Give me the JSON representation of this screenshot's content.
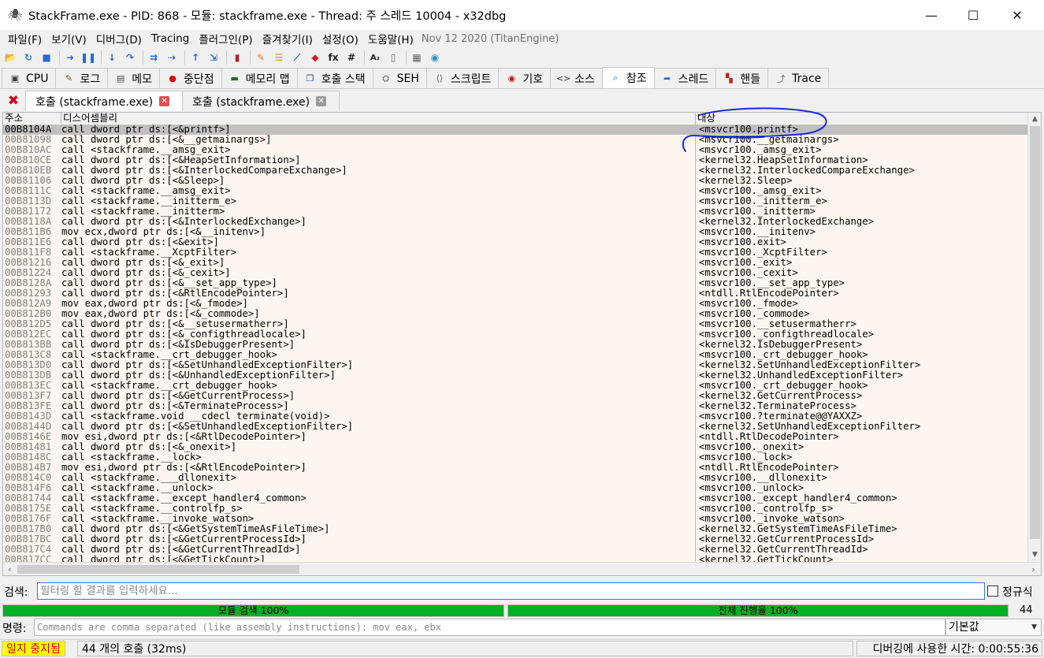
{
  "window": {
    "title": "StackFrame.exe - PID: 868 - 모듈: stackframe.exe - Thread: 주 스레드 10004 - x32dbg",
    "minimize": "—",
    "maximize": "☐",
    "close": "✕"
  },
  "menu": {
    "items": [
      "파일(F)",
      "보기(V)",
      "디버그(D)",
      "Tracing",
      "플러그인(P)",
      "즐겨찾기(I)",
      "설정(O)",
      "도움말(H)"
    ],
    "build": "Nov 12 2020 (TitanEngine)"
  },
  "toolbar": {
    "icons": [
      "open-icon",
      "restart-icon",
      "stop-icon",
      "run-icon",
      "pause-icon",
      "step-into-icon",
      "step-over-icon",
      "trace-into-icon",
      "trace-over-icon",
      "execute-till-return-icon",
      "run-to-user-code-icon",
      "scylla-icon",
      "patches-icon",
      "comments-icon",
      "labels-icon",
      "bookmarks-icon",
      "functions-icon",
      "variables-icon",
      "strings-icon",
      "calculator-icon",
      "globe-icon"
    ],
    "glyphs": [
      "📂",
      "↻",
      "■",
      "➜",
      "❚❚",
      "↓",
      "↷",
      "⇉",
      "⇢",
      "↑",
      "⇲",
      "▮",
      "✎",
      "☰",
      "⟋",
      "◆",
      "fx",
      "#",
      "A₂",
      "▯",
      "▦",
      "◉"
    ]
  },
  "tabs": [
    {
      "label": "CPU",
      "icon": "cpu-icon",
      "glyph": "▣",
      "color": "#3a3a3a"
    },
    {
      "label": "로그",
      "icon": "log-icon",
      "glyph": "✎",
      "color": "#6a5a2a"
    },
    {
      "label": "메모",
      "icon": "notes-icon",
      "glyph": "▤",
      "color": "#4a4a4a"
    },
    {
      "label": "중단점",
      "icon": "breakpoint-icon",
      "glyph": "●",
      "color": "#e00000"
    },
    {
      "label": "메모리 맵",
      "icon": "memory-map-icon",
      "glyph": "▬",
      "color": "#207020"
    },
    {
      "label": "호출 스택",
      "icon": "call-stack-icon",
      "glyph": "❐",
      "color": "#2a4a9a"
    },
    {
      "label": "SEH",
      "icon": "seh-icon",
      "glyph": "⛭",
      "color": "#555555"
    },
    {
      "label": "스크립트",
      "icon": "script-icon",
      "glyph": "⟨⟩",
      "color": "#555555"
    },
    {
      "label": "기호",
      "icon": "symbols-icon",
      "glyph": "◉",
      "color": "#b02020"
    },
    {
      "label": "소스",
      "icon": "source-icon",
      "glyph": "<>",
      "color": "#333333"
    },
    {
      "label": "참조",
      "icon": "references-icon",
      "glyph": "⌕",
      "color": "#2a5ab0"
    },
    {
      "label": "스레드",
      "icon": "threads-icon",
      "glyph": "➦",
      "color": "#2a6ad0"
    },
    {
      "label": "핸들",
      "icon": "handles-icon",
      "glyph": "▚",
      "color": "#c02020"
    },
    {
      "label": "Trace",
      "icon": "trace-icon",
      "glyph": "⤴",
      "color": "#555555"
    }
  ],
  "active_tab": "참조",
  "subtabs": {
    "close_all": "✖",
    "items": [
      "호출 (stackframe.exe)",
      "호출 (stackframe.exe)"
    ],
    "close_glyph": "✕"
  },
  "table": {
    "headers": [
      "주소",
      "디스어셈블리",
      "대상"
    ],
    "rows": [
      {
        "addr": "00B8104A",
        "dis": "call dword ptr ds:[<&printf>]",
        "tgt": "<msvcr100.printf>"
      },
      {
        "addr": "00B81098",
        "dis": "call dword ptr ds:[<&__getmainargs>]",
        "tgt": "<msvcr100.__getmainargs>"
      },
      {
        "addr": "00B810AC",
        "dis": "call <stackframe.__amsg_exit>",
        "tgt": "<msvcr100._amsg_exit>"
      },
      {
        "addr": "00B810CE",
        "dis": "call dword ptr ds:[<&HeapSetInformation>]",
        "tgt": "<kernel32.HeapSetInformation>"
      },
      {
        "addr": "00B810EB",
        "dis": "call dword ptr ds:[<&InterlockedCompareExchange>]",
        "tgt": "<kernel32.InterlockedCompareExchange>"
      },
      {
        "addr": "00B81106",
        "dis": "call dword ptr ds:[<&Sleep>]",
        "tgt": "<kernel32.Sleep>"
      },
      {
        "addr": "00B8111C",
        "dis": "call <stackframe.__amsg_exit>",
        "tgt": "<msvcr100._amsg_exit>"
      },
      {
        "addr": "00B8113D",
        "dis": "call <stackframe.__initterm_e>",
        "tgt": "<msvcr100._initterm_e>"
      },
      {
        "addr": "00B81172",
        "dis": "call <stackframe.__initterm>",
        "tgt": "<msvcr100._initterm>"
      },
      {
        "addr": "00B8118A",
        "dis": "call dword ptr ds:[<&InterlockedExchange>]",
        "tgt": "<kernel32.InterlockedExchange>"
      },
      {
        "addr": "00B811B6",
        "dis": "mov ecx,dword ptr ds:[<&__initenv>]",
        "tgt": "<msvcr100.__initenv>"
      },
      {
        "addr": "00B811E6",
        "dis": "call dword ptr ds:[<&exit>]",
        "tgt": "<msvcr100.exit>"
      },
      {
        "addr": "00B811F8",
        "dis": "call <stackframe.__XcptFilter>",
        "tgt": "<msvcr100._XcptFilter>"
      },
      {
        "addr": "00B81216",
        "dis": "call dword ptr ds:[<&_exit>]",
        "tgt": "<msvcr100._exit>"
      },
      {
        "addr": "00B81224",
        "dis": "call dword ptr ds:[<&_cexit>]",
        "tgt": "<msvcr100._cexit>"
      },
      {
        "addr": "00B8128A",
        "dis": "call dword ptr ds:[<&__set_app_type>]",
        "tgt": "<msvcr100.__set_app_type>"
      },
      {
        "addr": "00B81293",
        "dis": "call dword ptr ds:[<&RtlEncodePointer>]",
        "tgt": "<ntdll.RtlEncodePointer>"
      },
      {
        "addr": "00B812A9",
        "dis": "mov eax,dword ptr ds:[<&_fmode>]",
        "tgt": "<msvcr100._fmode>"
      },
      {
        "addr": "00B812B0",
        "dis": "mov eax,dword ptr ds:[<&_commode>]",
        "tgt": "<msvcr100._commode>"
      },
      {
        "addr": "00B812D5",
        "dis": "call dword ptr ds:[<&__setusermatherr>]",
        "tgt": "<msvcr100.__setusermatherr>"
      },
      {
        "addr": "00B812EC",
        "dis": "call dword ptr ds:[<&_configthreadlocale>]",
        "tgt": "<msvcr100._configthreadlocale>"
      },
      {
        "addr": "00B813BB",
        "dis": "call dword ptr ds:[<&IsDebuggerPresent>]",
        "tgt": "<kernel32.IsDebuggerPresent>"
      },
      {
        "addr": "00B813C8",
        "dis": "call <stackframe.__crt_debugger_hook>",
        "tgt": "<msvcr100._crt_debugger_hook>"
      },
      {
        "addr": "00B813D0",
        "dis": "call dword ptr ds:[<&SetUnhandledExceptionFilter>]",
        "tgt": "<kernel32.SetUnhandledExceptionFilter>"
      },
      {
        "addr": "00B813DB",
        "dis": "call dword ptr ds:[<&UnhandledExceptionFilter>]",
        "tgt": "<kernel32.UnhandledExceptionFilter>"
      },
      {
        "addr": "00B813EC",
        "dis": "call <stackframe.__crt_debugger_hook>",
        "tgt": "<msvcr100._crt_debugger_hook>"
      },
      {
        "addr": "00B813F7",
        "dis": "call dword ptr ds:[<&GetCurrentProcess>]",
        "tgt": "<kernel32.GetCurrentProcess>"
      },
      {
        "addr": "00B813FE",
        "dis": "call dword ptr ds:[<&TerminateProcess>]",
        "tgt": "<kernel32.TerminateProcess>"
      },
      {
        "addr": "00B8143D",
        "dis": "call <stackframe.void __cdecl terminate(void)>",
        "tgt": "<msvcr100.?terminate@@YAXXZ>"
      },
      {
        "addr": "00B8144D",
        "dis": "call dword ptr ds:[<&SetUnhandledExceptionFilter>]",
        "tgt": "<kernel32.SetUnhandledExceptionFilter>"
      },
      {
        "addr": "00B8146E",
        "dis": "mov esi,dword ptr ds:[<&RtlDecodePointer>]",
        "tgt": "<ntdll.RtlDecodePointer>"
      },
      {
        "addr": "00B81481",
        "dis": "call dword ptr ds:[<&_onexit>]",
        "tgt": "<msvcr100._onexit>"
      },
      {
        "addr": "00B8148C",
        "dis": "call <stackframe.__lock>",
        "tgt": "<msvcr100._lock>"
      },
      {
        "addr": "00B814B7",
        "dis": "mov esi,dword ptr ds:[<&RtlEncodePointer>]",
        "tgt": "<ntdll.RtlEncodePointer>"
      },
      {
        "addr": "00B814C0",
        "dis": "call <stackframe.___dllonexit>",
        "tgt": "<msvcr100.__dllonexit>"
      },
      {
        "addr": "00B814F6",
        "dis": "call <stackframe.__unlock>",
        "tgt": "<msvcr100._unlock>"
      },
      {
        "addr": "00B81744",
        "dis": "call <stackframe.__except_handler4_common>",
        "tgt": "<msvcr100._except_handler4_common>"
      },
      {
        "addr": "00B8175E",
        "dis": "call <stackframe.__controlfp_s>",
        "tgt": "<msvcr100._controlfp_s>"
      },
      {
        "addr": "00B8176F",
        "dis": "call <stackframe.__invoke_watson>",
        "tgt": "<msvcr100._invoke_watson>"
      },
      {
        "addr": "00B817B0",
        "dis": "call dword ptr ds:[<&GetSystemTimeAsFileTime>]",
        "tgt": "<kernel32.GetSystemTimeAsFileTime>"
      },
      {
        "addr": "00B817BC",
        "dis": "call dword ptr ds:[<&GetCurrentProcessId>]",
        "tgt": "<kernel32.GetCurrentProcessId>"
      },
      {
        "addr": "00B817C4",
        "dis": "call dword ptr ds:[<&GetCurrentThreadId>]",
        "tgt": "<kernel32.GetCurrentThreadId>"
      },
      {
        "addr": "00B817CC",
        "dis": "call dword ptr ds:[<&GetTickCount>]",
        "tgt": "<kernel32.GetTickCount>"
      }
    ]
  },
  "search": {
    "label": "검색:",
    "placeholder": "필터링 할 결과를 입력하세요...",
    "regex_label": "정규식"
  },
  "progress": {
    "module_label": "모듈 검색 100%",
    "module_fraction": 1.0,
    "total_label": "전체 진행율 100%",
    "total_fraction": 1.0,
    "count": "44",
    "fill_color": "#06b025"
  },
  "command": {
    "label": "명령:",
    "placeholder": "Commands are comma separated (like assembly instructions): mov eax, ebx",
    "selected": "기본값"
  },
  "status": {
    "state": "일지 중지됨",
    "message": "44 개의 호출 (32ms)",
    "time": "디버깅에 사용한 시간: 0:00:55:36"
  }
}
